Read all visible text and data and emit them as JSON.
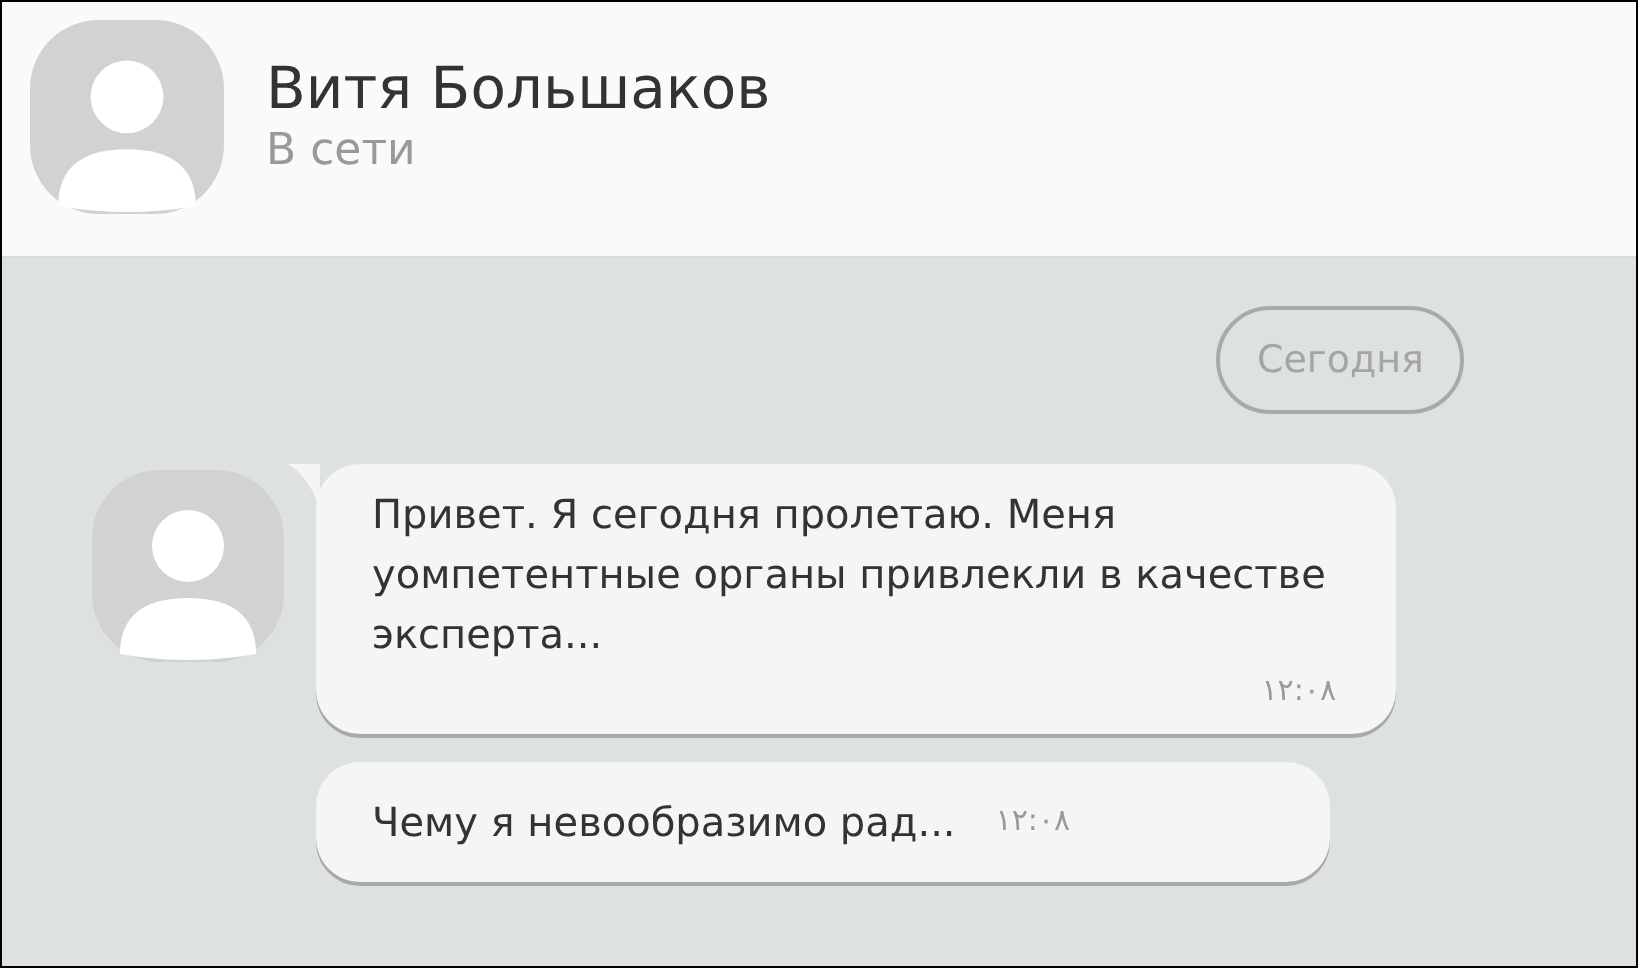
{
  "header": {
    "name": "Витя Большаков",
    "status": "В сети"
  },
  "date_pill": "Сегодня",
  "messages": [
    {
      "kind": "first",
      "text": "Привет. Я сегодня пролетаю. Меня уомпетентные органы привлекли в качестве эксперта...",
      "time": "١٢:٠٨"
    },
    {
      "kind": "inline",
      "text": "Чему я невообразимо рад...",
      "time": "١٢:٠٨"
    }
  ]
}
